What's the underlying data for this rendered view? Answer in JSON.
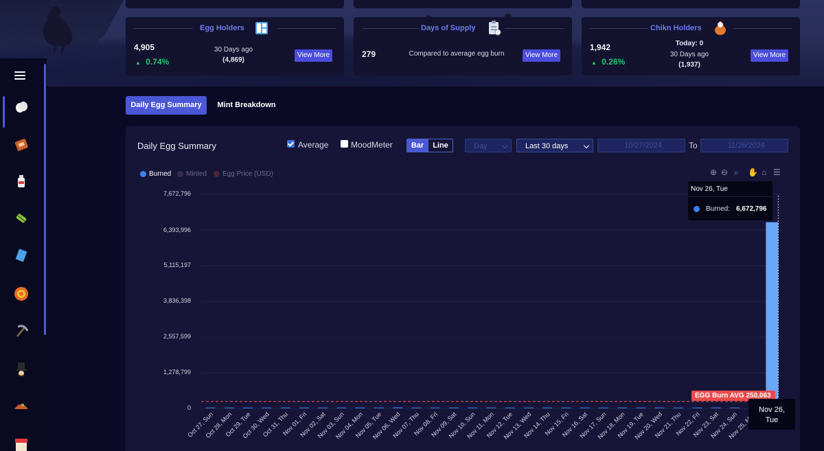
{
  "top_cards": [
    {
      "title": "Egg Holders",
      "value": "4,905",
      "change": "0.74%",
      "sub1": "30 Days ago",
      "sub2": "(4,869)",
      "button": "View More"
    },
    {
      "title": "Days of Supply",
      "value": "279",
      "desc": "Compared to average egg burn",
      "button": "View More"
    },
    {
      "title": "Chikn Holders",
      "value": "1,942",
      "change": "0.26%",
      "sub0": "Today: 0",
      "sub1": "30 Days ago",
      "sub2": "(1,937)",
      "button": "View More"
    }
  ],
  "sidebar": {
    "icons": [
      "menu-icon",
      "egg-icon",
      "bag-icon",
      "bottle-icon",
      "candy-icon",
      "ticket-icon",
      "badge-icon",
      "pickaxe-icon",
      "top-hat-icon",
      "food-icon",
      "shop-icon"
    ]
  },
  "tabs": [
    {
      "label": "Daily Egg Summary",
      "active": true
    },
    {
      "label": "Mint Breakdown",
      "active": false
    }
  ],
  "panel": {
    "title": "Daily Egg Summary",
    "average_label": "Average",
    "average_checked": true,
    "moodmeter_label": "MoodMeter",
    "moodmeter_checked": false,
    "seg_bar": "Bar",
    "seg_line": "Line",
    "interval": "Day",
    "range": "Last 30 days",
    "date_from": "10/27/2024",
    "to_label": "To",
    "date_to": "11/26/2024"
  },
  "tooltip": {
    "header": "Nov 26, Tue",
    "label": "Burned:",
    "value": "6,672,796"
  },
  "x_tooltip": {
    "line1": "Nov 26,",
    "line2": "Tue"
  },
  "avg_label": "EGG Burn AVG 250,063",
  "colors": {
    "burned": "#3b82f6",
    "minted": "#3a2b55",
    "egg_price": "#4a2436",
    "accent": "#4a58d6",
    "average_line": "#e94b4b"
  },
  "chart_data": {
    "type": "bar",
    "legend": [
      "Burned",
      "Minted",
      "Egg Price (USD)"
    ],
    "legend_active": [
      true,
      false,
      false
    ],
    "categories": [
      "Oct 27, Sun",
      "Oct 28, Mon",
      "Oct 29, Tue",
      "Oct 30, Wed",
      "Oct 31, Thu",
      "Nov 01, Fri",
      "Nov 02, Sat",
      "Nov 03, Sun",
      "Nov 04, Mon",
      "Nov 05, Tue",
      "Nov 06, Wed",
      "Nov 07, Thu",
      "Nov 08, Fri",
      "Nov 09, Sat",
      "Nov 10, Sun",
      "Nov 11, Mon",
      "Nov 12, Tue",
      "Nov 13, Wed",
      "Nov 14, Thu",
      "Nov 15, Fri",
      "Nov 16, Sat",
      "Nov 17, Sun",
      "Nov 18, Mon",
      "Nov 19, Tue",
      "Nov 20, Wed",
      "Nov 21, Thu",
      "Nov 22, Fri",
      "Nov 23, Sat",
      "Nov 24, Sun",
      "Nov 25, Mon",
      "Nov 26, Tue"
    ],
    "series": [
      {
        "name": "Burned",
        "values": [
          15000,
          20000,
          14000,
          12000,
          16000,
          13000,
          15000,
          14000,
          16000,
          15000,
          45000,
          17000,
          14000,
          15000,
          13000,
          16000,
          15000,
          14000,
          16000,
          15000,
          14000,
          13000,
          17000,
          15000,
          16000,
          14000,
          15000,
          16000,
          15000,
          20000,
          6672796
        ]
      }
    ],
    "average": 250063,
    "yticks": [
      "7,672,796",
      "6,393,996",
      "5,115,197",
      "3,836,398",
      "2,557,599",
      "1,278,799",
      "0"
    ],
    "ylim": [
      0,
      7672796
    ],
    "grid": true,
    "legend_position": "top-left"
  },
  "toolbar": [
    "zoom-in-icon",
    "zoom-out-icon",
    "zoom-select-icon",
    "pan-icon",
    "home-icon",
    "menu-icon"
  ]
}
